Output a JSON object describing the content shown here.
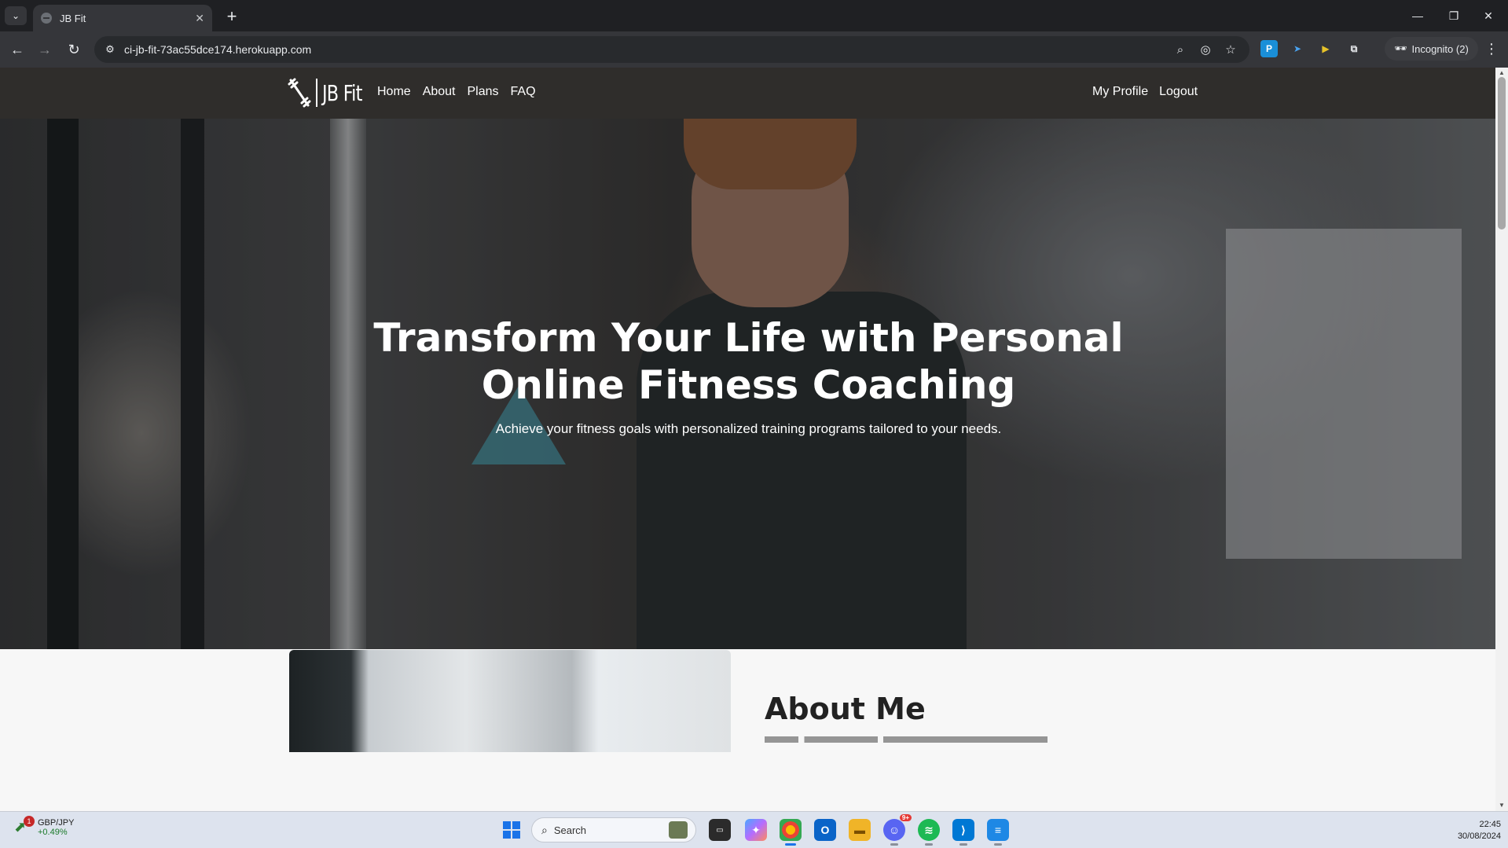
{
  "browser": {
    "tab_title": "JB Fit",
    "url": "ci-jb-fit-73ac55dce174.herokuapp.com",
    "incognito_label": "Incognito (2)"
  },
  "site": {
    "logo_text": "JB Fit",
    "nav_links": [
      "Home",
      "About",
      "Plans",
      "FAQ"
    ],
    "nav_right": [
      "My Profile",
      "Logout"
    ]
  },
  "hero": {
    "title": "Transform Your Life with Personal Online Fitness Coaching",
    "subtitle": "Achieve your fitness goals with personalized training programs tailored to your needs."
  },
  "about": {
    "title": "About Me"
  },
  "taskbar": {
    "widget_name": "GBP/JPY",
    "widget_change": "+0.49%",
    "widget_badge": "1",
    "search_label": "Search",
    "time": "22:45",
    "date": "30/08/2024",
    "discord_badge": "9+"
  },
  "colors": {
    "browser_frame": "#202124",
    "toolbar": "#35363a",
    "site_nav": "#2f2d2b",
    "page_bg": "#f7f7f7",
    "taskbar": "#dde3ee"
  }
}
